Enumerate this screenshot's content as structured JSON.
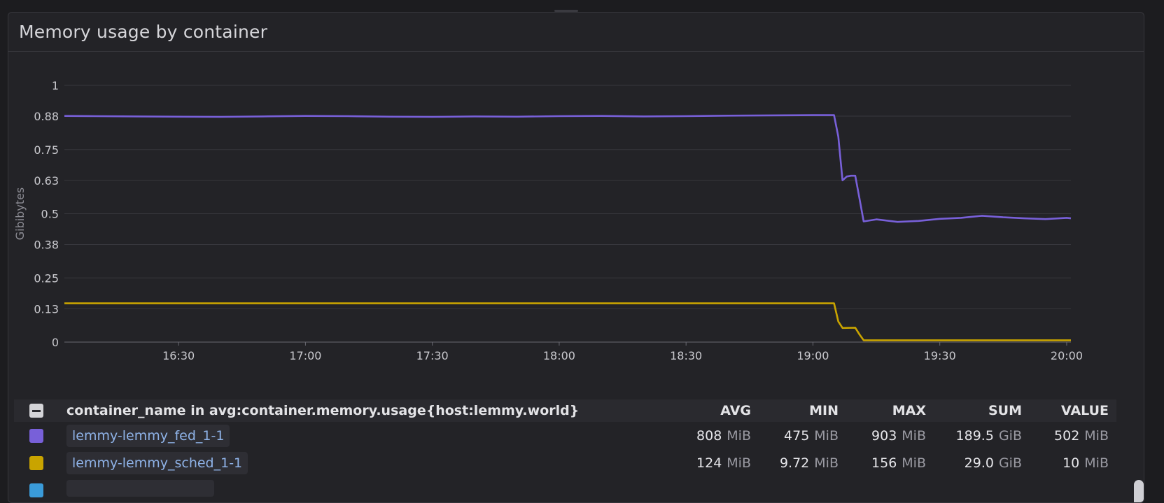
{
  "panel": {
    "title": "Memory usage by container"
  },
  "chart_data": {
    "type": "line",
    "title": "Memory usage by container",
    "ylabel": "Gibibytes",
    "xlabel": "",
    "ylim": [
      0,
      1
    ],
    "yticks": [
      0,
      0.13,
      0.25,
      0.38,
      0.5,
      0.63,
      0.75,
      0.88,
      1
    ],
    "ytick_labels": [
      "0",
      "0.13",
      "0.25",
      "0.38",
      "0.5",
      "0.63",
      "0.75",
      "0.88",
      "1"
    ],
    "xlim": [
      "16:03",
      "20:01"
    ],
    "xticks": [
      "16:30",
      "17:00",
      "17:30",
      "18:00",
      "18:30",
      "19:00",
      "19:30",
      "20:00"
    ],
    "grid": true,
    "series": [
      {
        "name": "lemmy-lemmy_fed_1-1",
        "color": "#7860d9",
        "x": [
          "16:03",
          "16:10",
          "16:20",
          "16:30",
          "16:40",
          "16:50",
          "17:00",
          "17:10",
          "17:20",
          "17:30",
          "17:40",
          "17:50",
          "18:00",
          "18:10",
          "18:20",
          "18:30",
          "18:40",
          "18:50",
          "19:00",
          "19:05",
          "19:06",
          "19:07",
          "19:08",
          "19:09",
          "19:10",
          "19:11",
          "19:12",
          "19:15",
          "19:20",
          "19:25",
          "19:30",
          "19:35",
          "19:40",
          "19:45",
          "19:50",
          "19:55",
          "20:00",
          "20:01"
        ],
        "values": [
          0.881,
          0.88,
          0.879,
          0.878,
          0.877,
          0.879,
          0.881,
          0.88,
          0.878,
          0.877,
          0.879,
          0.878,
          0.88,
          0.881,
          0.879,
          0.88,
          0.882,
          0.883,
          0.884,
          0.884,
          0.8,
          0.63,
          0.645,
          0.648,
          0.648,
          0.56,
          0.47,
          0.478,
          0.468,
          0.472,
          0.48,
          0.484,
          0.492,
          0.486,
          0.482,
          0.479,
          0.484,
          0.482
        ]
      },
      {
        "name": "lemmy-lemmy_sched_1-1",
        "color": "#c9a400",
        "x": [
          "16:03",
          "18:00",
          "19:04",
          "19:05",
          "19:06",
          "19:07",
          "19:10",
          "19:11",
          "19:12",
          "19:20",
          "20:01"
        ],
        "values": [
          0.151,
          0.151,
          0.151,
          0.151,
          0.08,
          0.055,
          0.056,
          0.03,
          0.007,
          0.007,
          0.007
        ]
      }
    ]
  },
  "legend": {
    "header": {
      "query": "container_name in avg:container.memory.usage{host:lemmy.world}",
      "avg": "AVG",
      "min": "MIN",
      "max": "MAX",
      "sum": "SUM",
      "value": "VALUE"
    },
    "rows": [
      {
        "name": "lemmy-lemmy_fed_1-1",
        "color": "#7860d9",
        "avg": "808",
        "avg_unit": "MiB",
        "min": "475",
        "min_unit": "MiB",
        "max": "903",
        "max_unit": "MiB",
        "sum": "189.5",
        "sum_unit": "GiB",
        "value": "502",
        "value_unit": "MiB"
      },
      {
        "name": "lemmy-lemmy_sched_1-1",
        "color": "#c9a400",
        "avg": "124",
        "avg_unit": "MiB",
        "min": "9.72",
        "min_unit": "MiB",
        "max": "156",
        "max_unit": "MiB",
        "sum": "29.0",
        "sum_unit": "GiB",
        "value": "10",
        "value_unit": "MiB"
      },
      {
        "name": "",
        "color": "#3a9bd9"
      }
    ]
  }
}
